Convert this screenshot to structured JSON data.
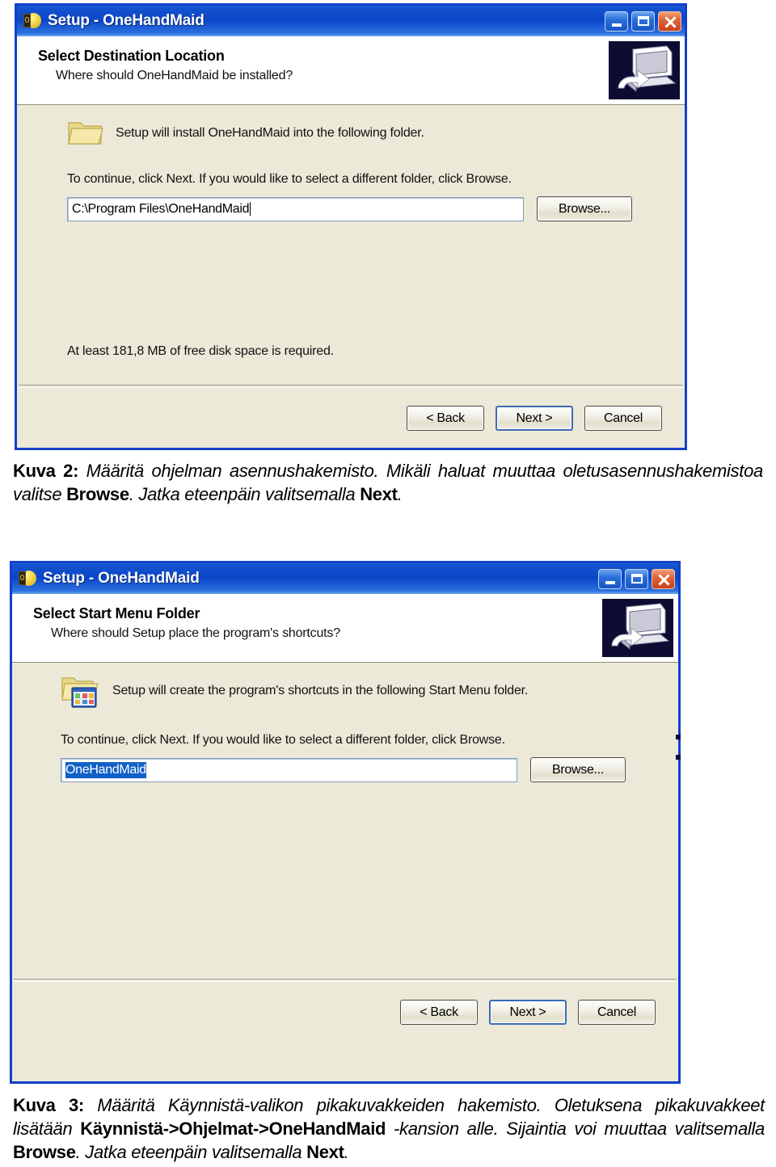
{
  "dialog1": {
    "name": "select-destination-location",
    "titlebar": {
      "title": "Setup - OneHandMaid",
      "icon": "setup-app-icon",
      "icon_glyph": "0",
      "minimize_label": "Minimize",
      "maximize_label": "Maximize",
      "close_label": "Close"
    },
    "header": {
      "heading": "Select Destination Location",
      "subheading": "Where should OneHandMaid be installed?",
      "wizard_icon": "computer-install-icon"
    },
    "body": {
      "folder_icon": "folder-icon",
      "lead": "Setup will install OneHandMaid into the following folder.",
      "instruction": "To continue, click Next. If you would like to select a different folder, click Browse.",
      "path_value": "C:\\Program Files\\OneHandMaid",
      "path_placeholder": "C:\\Program Files\\OneHandMaid",
      "browse_label": "Browse...",
      "free_space": "At least 181,8 MB of free disk space is required."
    },
    "buttons": {
      "back": "< Back",
      "next": "Next >",
      "cancel": "Cancel"
    }
  },
  "caption2": {
    "label": "Kuva 2:",
    "text_1": " Määritä ohjelman asennushakemisto. Mikäli haluat muuttaa oletusasennushakemistoa valitse ",
    "bold_1": "Browse",
    "text_2": ". Jatka eteenpäin valitsemalla ",
    "bold_2": "Next",
    "text_3": "."
  },
  "dialog2": {
    "name": "select-start-menu-folder",
    "titlebar": {
      "title": "Setup - OneHandMaid",
      "icon": "setup-app-icon",
      "icon_glyph": "0",
      "minimize_label": "Minimize",
      "maximize_label": "Maximize",
      "close_label": "Close"
    },
    "header": {
      "heading": "Select Start Menu Folder",
      "subheading": "Where should Setup place the program's shortcuts?",
      "wizard_icon": "computer-install-icon"
    },
    "body": {
      "folder_icon": "program-group-folder-icon",
      "lead": "Setup will create the program's shortcuts in the following Start Menu folder.",
      "instruction": "To continue, click Next. If you would like to select a different folder, click Browse.",
      "folder_value": "OneHandMaid",
      "folder_placeholder": "OneHandMaid",
      "folder_value_selected": true,
      "browse_label": "Browse..."
    },
    "buttons": {
      "back": "< Back",
      "next": "Next >",
      "cancel": "Cancel"
    }
  },
  "caption3": {
    "label": "Kuva 3:",
    "text_1": " Määritä Käynnistä-valikon pikakuvakkeiden hakemisto. Oletuksena pikakuvakkeet lisätään ",
    "bold_1": "Käynnistä->Ohjelmat->OneHandMaid",
    "text_2": " -kansion alle. Sijaintia voi muuttaa valitsemalla ",
    "bold_2": "Browse",
    "text_3": ". Jatka eteenpäin valitsemalla ",
    "bold_3": "Next",
    "text_4": "."
  },
  "colors": {
    "titlebar_blue": "#0b46c8",
    "window_border": "#1340c8",
    "dialog_face": "#ece9d8",
    "selection_blue": "#1160c8",
    "close_red": "#c9401c",
    "wizard_bg": "#0d0d33"
  }
}
